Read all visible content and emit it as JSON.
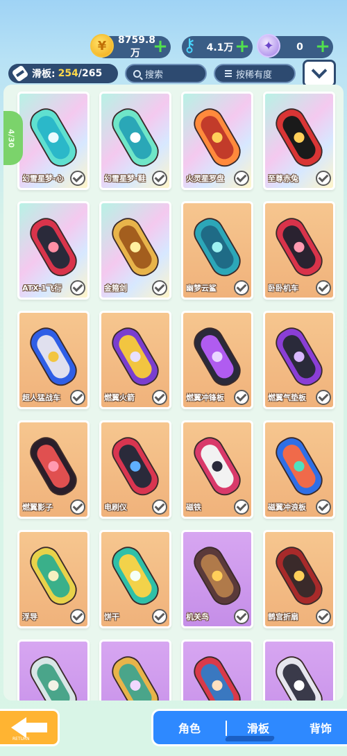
{
  "currencies": {
    "coins": {
      "value": "8759.8万",
      "icon": "coin-icon"
    },
    "keys": {
      "value": "4.1万",
      "icon": "key-icon"
    },
    "gems": {
      "value": "0",
      "icon": "gem-icon"
    }
  },
  "toolbar": {
    "board_label": "滑板:",
    "owned": "254",
    "total": "/265",
    "search_placeholder": "搜索",
    "sort_label": "按稀有度"
  },
  "side_badge": "4/30",
  "cards": [
    {
      "name": "幻雪星梦-心",
      "bg": "rainbow",
      "owned": true
    },
    {
      "name": "幻雪星梦-鞋",
      "bg": "rainbow",
      "owned": true
    },
    {
      "name": "火灵星罗盘",
      "bg": "rainbow",
      "owned": true
    },
    {
      "name": "至尊赤兔",
      "bg": "rainbow",
      "owned": true
    },
    {
      "name": "ATX-1飞行",
      "bg": "rainbow",
      "owned": true
    },
    {
      "name": "金箍剑",
      "bg": "rainbow",
      "owned": true
    },
    {
      "name": "幽梦云鲨",
      "bg": "orange",
      "owned": true
    },
    {
      "name": "卧卧机车",
      "bg": "orange",
      "owned": true
    },
    {
      "name": "超人猛战车",
      "bg": "orange",
      "owned": true
    },
    {
      "name": "燃翼火箭",
      "bg": "orange",
      "owned": true
    },
    {
      "name": "燃翼冲锋板",
      "bg": "orange",
      "owned": true
    },
    {
      "name": "燃翼气垫板",
      "bg": "orange",
      "owned": true
    },
    {
      "name": "燃翼影子",
      "bg": "orange",
      "owned": true
    },
    {
      "name": "电刷仪",
      "bg": "orange",
      "owned": true
    },
    {
      "name": "磁铁",
      "bg": "orange",
      "owned": true
    },
    {
      "name": "磁翼冲浪板",
      "bg": "orange",
      "owned": true
    },
    {
      "name": "浮导",
      "bg": "orange",
      "owned": true
    },
    {
      "name": "饼干",
      "bg": "orange",
      "owned": true
    },
    {
      "name": "机关鸟",
      "bg": "purple",
      "owned": true
    },
    {
      "name": "鹊宫折扇",
      "bg": "orange",
      "owned": true
    },
    {
      "name": "",
      "bg": "purple",
      "owned": false
    },
    {
      "name": "",
      "bg": "purple",
      "owned": false
    },
    {
      "name": "",
      "bg": "purple",
      "owned": false
    },
    {
      "name": "",
      "bg": "purple",
      "owned": false
    }
  ],
  "back_button": {
    "label": "RETURN"
  },
  "tabs": [
    {
      "label": "角色"
    },
    {
      "label": "滑板"
    },
    {
      "label": "背饰"
    }
  ]
}
